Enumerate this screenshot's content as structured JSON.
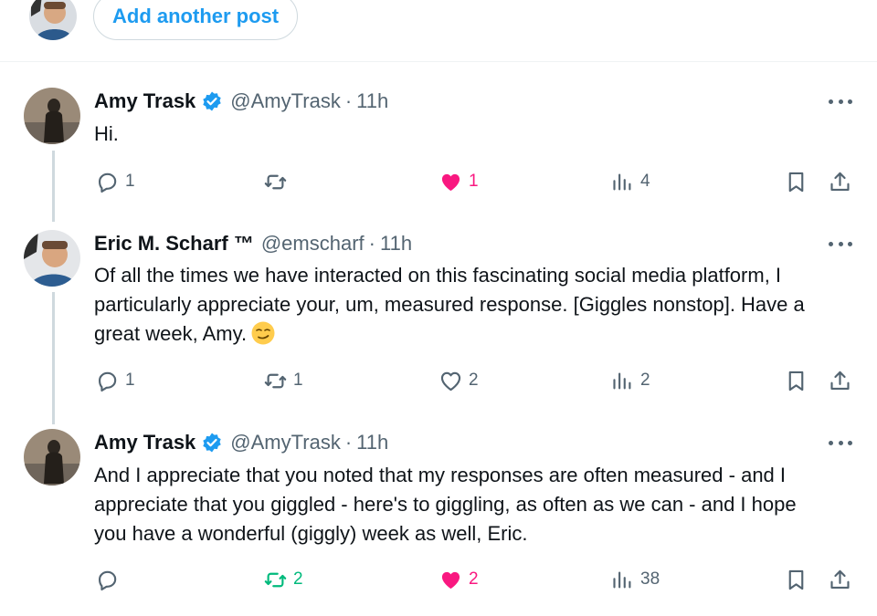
{
  "compose": {
    "add_post_label": "Add another post"
  },
  "posts": [
    {
      "display_name": "Amy Trask",
      "verified": true,
      "handle": "@AmyTrask",
      "separator": "·",
      "time": "11h",
      "text": "Hi.",
      "reply_count": "1",
      "repost_count": "",
      "like_count": "1",
      "view_count": "4",
      "liked": true,
      "reposted": false
    },
    {
      "display_name": "Eric M. Scharf ™",
      "verified": false,
      "handle": "@emscharf",
      "separator": "·",
      "time": "11h",
      "text": "Of all the times we have interacted on this fascinating social media platform, I particularly appreciate your, um, measured response. [Giggles nonstop]. Have a great week, Amy.",
      "emoji": "smirking-face-emoji",
      "reply_count": "1",
      "repost_count": "1",
      "like_count": "2",
      "view_count": "2",
      "liked": false,
      "reposted": false
    },
    {
      "display_name": "Amy Trask",
      "verified": true,
      "handle": "@AmyTrask",
      "separator": "·",
      "time": "11h",
      "text": "And I appreciate that you noted that my responses are often measured - and I appreciate that you giggled - here's to giggling, as often as we can - and I hope you have a wonderful (giggly) week as well, Eric.",
      "reply_count": "",
      "repost_count": "2",
      "like_count": "2",
      "view_count": "38",
      "liked": true,
      "reposted": true
    }
  ],
  "icons": {
    "reply": "reply-icon",
    "repost": "repost-icon",
    "like": "heart-icon",
    "views": "views-icon",
    "bookmark": "bookmark-icon",
    "share": "share-icon",
    "more": "more-icon",
    "verified": "verified-badge-icon"
  },
  "colors": {
    "accent": "#1d9bf0",
    "like": "#f91880",
    "repost": "#00ba7c",
    "muted": "#536471",
    "text": "#0f1419"
  }
}
